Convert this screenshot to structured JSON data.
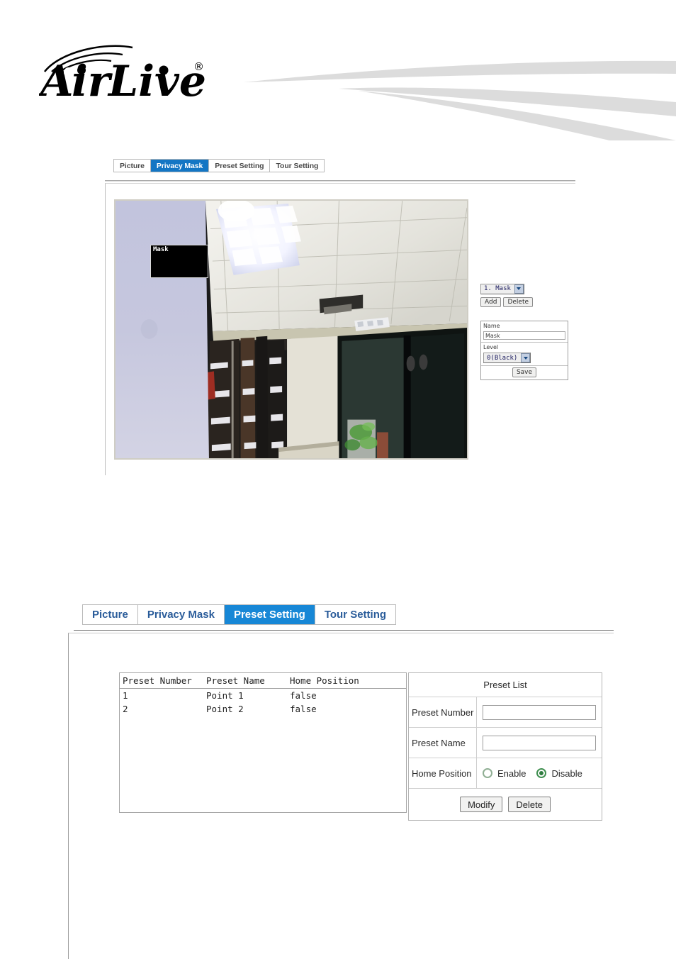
{
  "header": {
    "brand": "Air Live",
    "brand_mark": "®",
    "swoosh_color": "#dcdcdc"
  },
  "theme": {
    "tab_active_blue": "#1476c4",
    "tab_active_blue_large": "#1787d6",
    "tab_text": "#2a5c9a",
    "radio_green": "#2f7c40"
  },
  "privacy_mask_section": {
    "tabs": [
      {
        "label": "Picture",
        "active": false
      },
      {
        "label": "Privacy Mask",
        "active": true
      },
      {
        "label": "Preset Setting",
        "active": false
      },
      {
        "label": "Tour Setting",
        "active": false
      }
    ],
    "camera_view": {
      "mask_overlay_label": "Mask"
    },
    "controls": {
      "mask_select_value": "1. Mask",
      "add_label": "Add",
      "delete_label": "Delete"
    },
    "form": {
      "name_label": "Name",
      "name_value": "Mask",
      "level_label": "Level",
      "level_value": "0(Black)",
      "save_label": "Save"
    }
  },
  "preset_setting_section": {
    "tabs": [
      {
        "label": "Picture",
        "active": false
      },
      {
        "label": "Privacy Mask",
        "active": false
      },
      {
        "label": "Preset Setting",
        "active": true
      },
      {
        "label": "Tour Setting",
        "active": false
      }
    ],
    "table": {
      "columns": [
        "Preset Number",
        "Preset Name",
        "Home Position"
      ],
      "rows": [
        [
          "1",
          "Point 1",
          "false"
        ],
        [
          "2",
          "Point 2",
          "false"
        ]
      ]
    },
    "form": {
      "title": "Preset List",
      "preset_number_label": "Preset Number",
      "preset_number_value": "",
      "preset_name_label": "Preset Name",
      "preset_name_value": "",
      "home_position_label": "Home Position",
      "enable_label": "Enable",
      "disable_label": "Disable",
      "enable_selected": false,
      "disable_selected": true,
      "modify_label": "Modify",
      "delete_label": "Delete"
    }
  }
}
